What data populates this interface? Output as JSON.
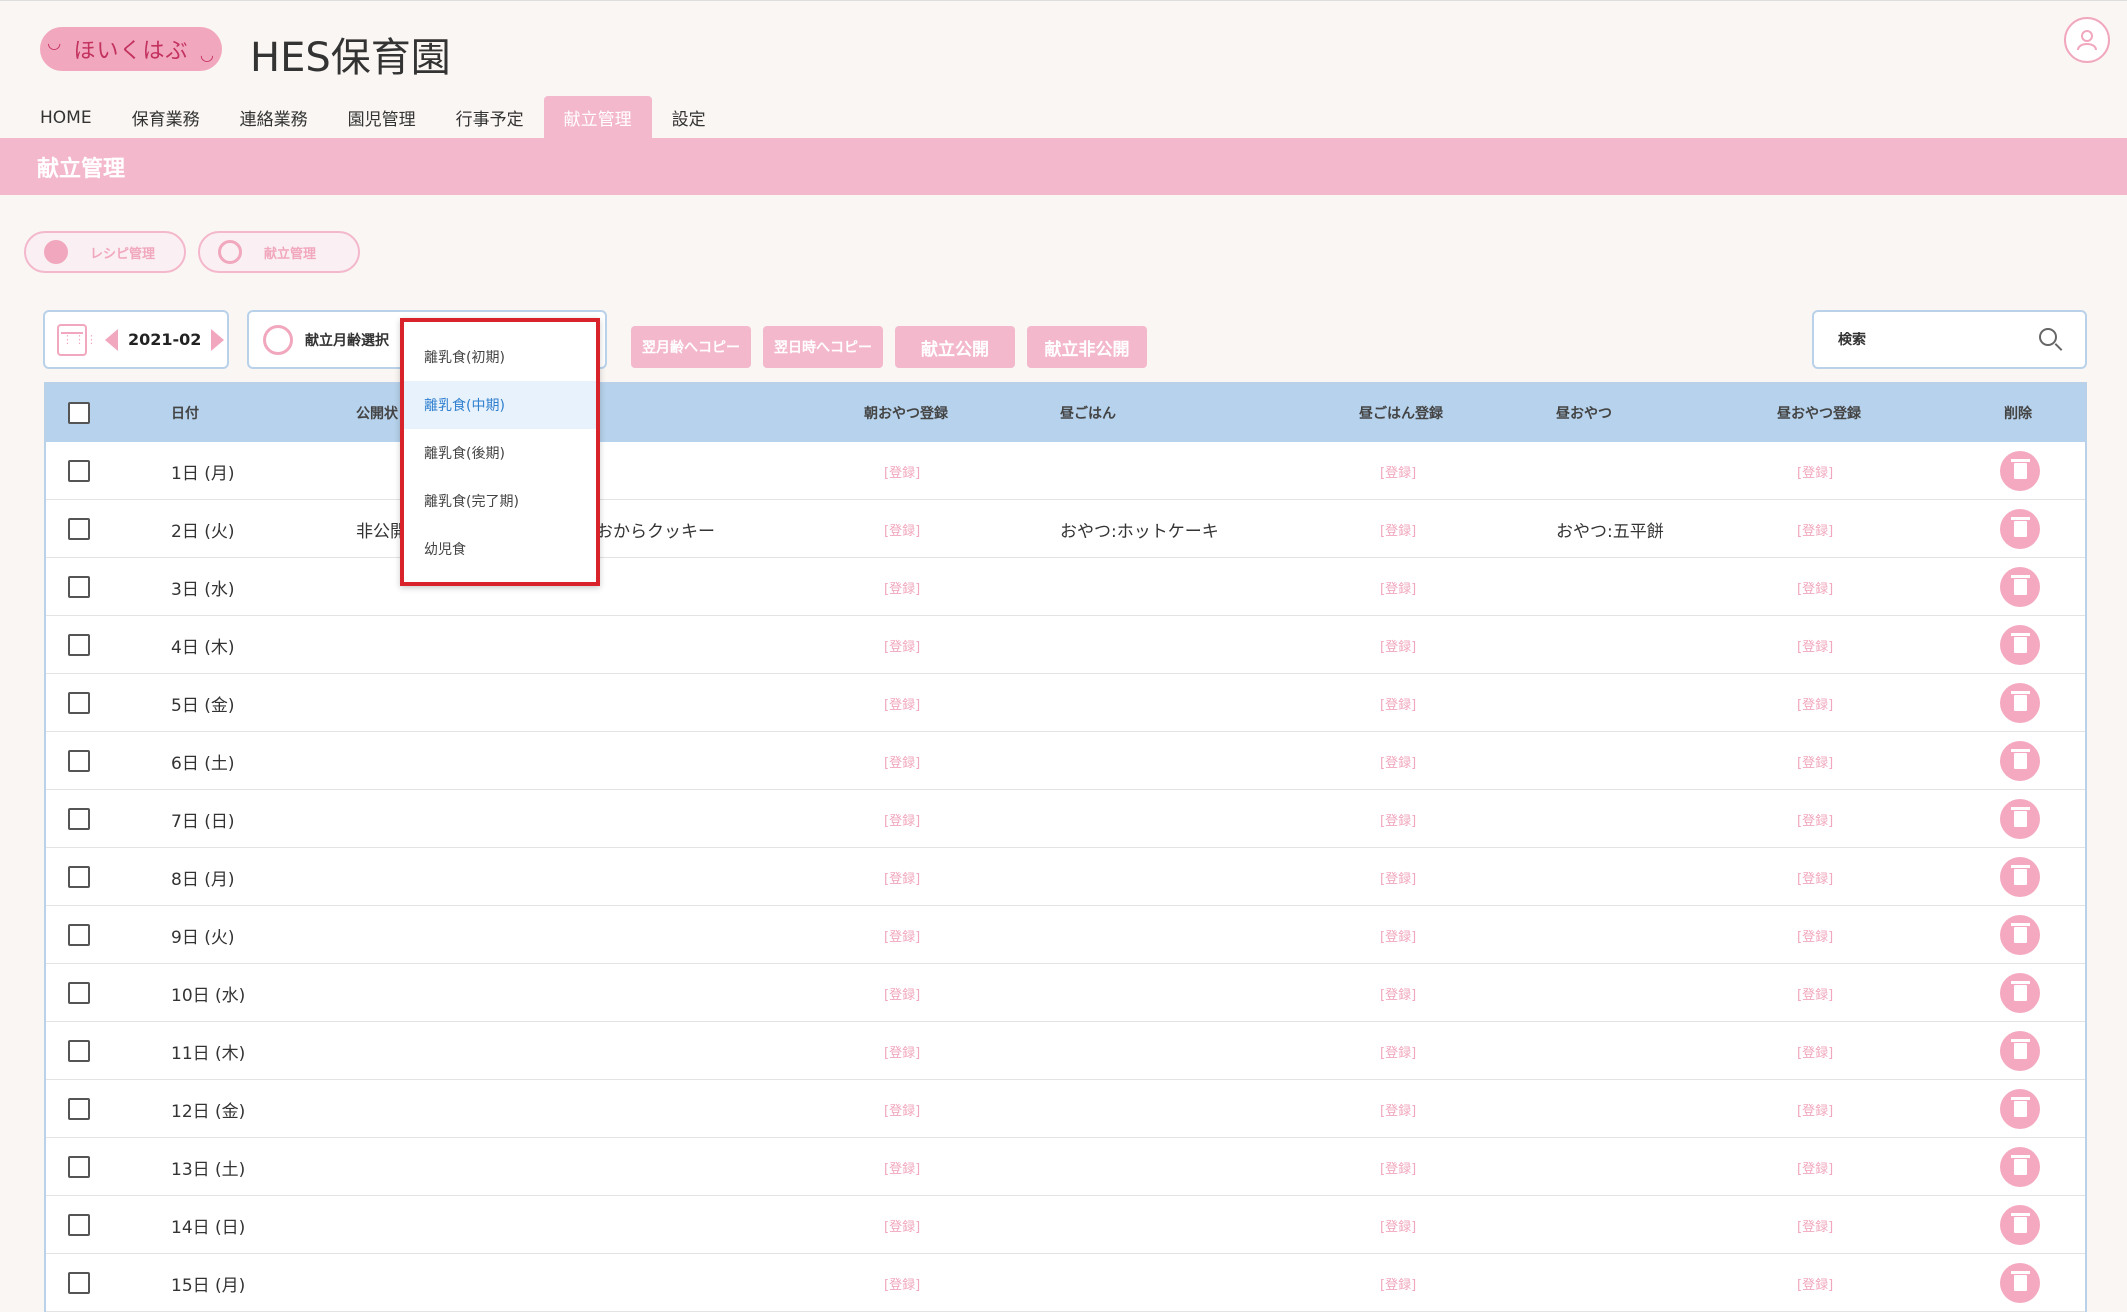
{
  "app": {
    "logo": "ほいくはぶ",
    "title": "HES保育園"
  },
  "nav": [
    {
      "label": "HOME",
      "active": false
    },
    {
      "label": "保育業務",
      "active": false
    },
    {
      "label": "連絡業務",
      "active": false
    },
    {
      "label": "園児管理",
      "active": false
    },
    {
      "label": "行事予定",
      "active": false
    },
    {
      "label": "献立管理",
      "active": true
    },
    {
      "label": "設定",
      "active": false
    }
  ],
  "banner": "献立管理",
  "subnav": {
    "recipe": "レシピ管理",
    "menu": "献立管理"
  },
  "toolbar": {
    "month": "2021-02",
    "age_label": "献立月齢選択",
    "copy_next_month": "翌月齢へコピー",
    "copy_next_day": "翌日時へコピー",
    "publish": "献立公開",
    "unpublish": "献立非公開",
    "search_placeholder": "検索"
  },
  "dropdown": {
    "options": [
      "離乳食(初期)",
      "離乳食(中期)",
      "離乳食(後期)",
      "離乳食(完了期)",
      "幼児食"
    ],
    "selected": "離乳食(中期)"
  },
  "table": {
    "headers": {
      "date": "日付",
      "status": "公開状",
      "morning_snack_reg": "朝おやつ登録",
      "lunch": "昼ごはん",
      "lunch_reg": "昼ごはん登録",
      "pm_snack": "昼おやつ",
      "pm_snack_reg": "昼おやつ登録",
      "delete": "削除"
    },
    "register_label": "[登録]",
    "rows": [
      {
        "date": "1日 (月)",
        "status": "",
        "morning_snack": "",
        "lunch": "",
        "pm_snack": ""
      },
      {
        "date": "2日 (火)",
        "status": "非公開",
        "morning_snack": "おからクッキー",
        "lunch": "おやつ:ホットケーキ",
        "pm_snack": "おやつ:五平餅"
      },
      {
        "date": "3日 (水)",
        "status": "",
        "morning_snack": "",
        "lunch": "",
        "pm_snack": ""
      },
      {
        "date": "4日 (木)",
        "status": "",
        "morning_snack": "",
        "lunch": "",
        "pm_snack": ""
      },
      {
        "date": "5日 (金)",
        "status": "",
        "morning_snack": "",
        "lunch": "",
        "pm_snack": ""
      },
      {
        "date": "6日 (土)",
        "status": "",
        "morning_snack": "",
        "lunch": "",
        "pm_snack": ""
      },
      {
        "date": "7日 (日)",
        "status": "",
        "morning_snack": "",
        "lunch": "",
        "pm_snack": ""
      },
      {
        "date": "8日 (月)",
        "status": "",
        "morning_snack": "",
        "lunch": "",
        "pm_snack": ""
      },
      {
        "date": "9日 (火)",
        "status": "",
        "morning_snack": "",
        "lunch": "",
        "pm_snack": ""
      },
      {
        "date": "10日 (水)",
        "status": "",
        "morning_snack": "",
        "lunch": "",
        "pm_snack": ""
      },
      {
        "date": "11日 (木)",
        "status": "",
        "morning_snack": "",
        "lunch": "",
        "pm_snack": ""
      },
      {
        "date": "12日 (金)",
        "status": "",
        "morning_snack": "",
        "lunch": "",
        "pm_snack": ""
      },
      {
        "date": "13日 (土)",
        "status": "",
        "morning_snack": "",
        "lunch": "",
        "pm_snack": ""
      },
      {
        "date": "14日 (日)",
        "status": "",
        "morning_snack": "",
        "lunch": "",
        "pm_snack": ""
      },
      {
        "date": "15日 (月)",
        "status": "",
        "morning_snack": "",
        "lunch": "",
        "pm_snack": ""
      }
    ]
  },
  "colors": {
    "accent": "#f4b8cc",
    "header_row": "#b6d2ec",
    "highlight_border": "#d8232a"
  },
  "icons": [
    "smile-icon",
    "user-icon",
    "rice-bowl-icon",
    "face-icon",
    "calendar-icon",
    "search-icon",
    "trash-icon"
  ]
}
